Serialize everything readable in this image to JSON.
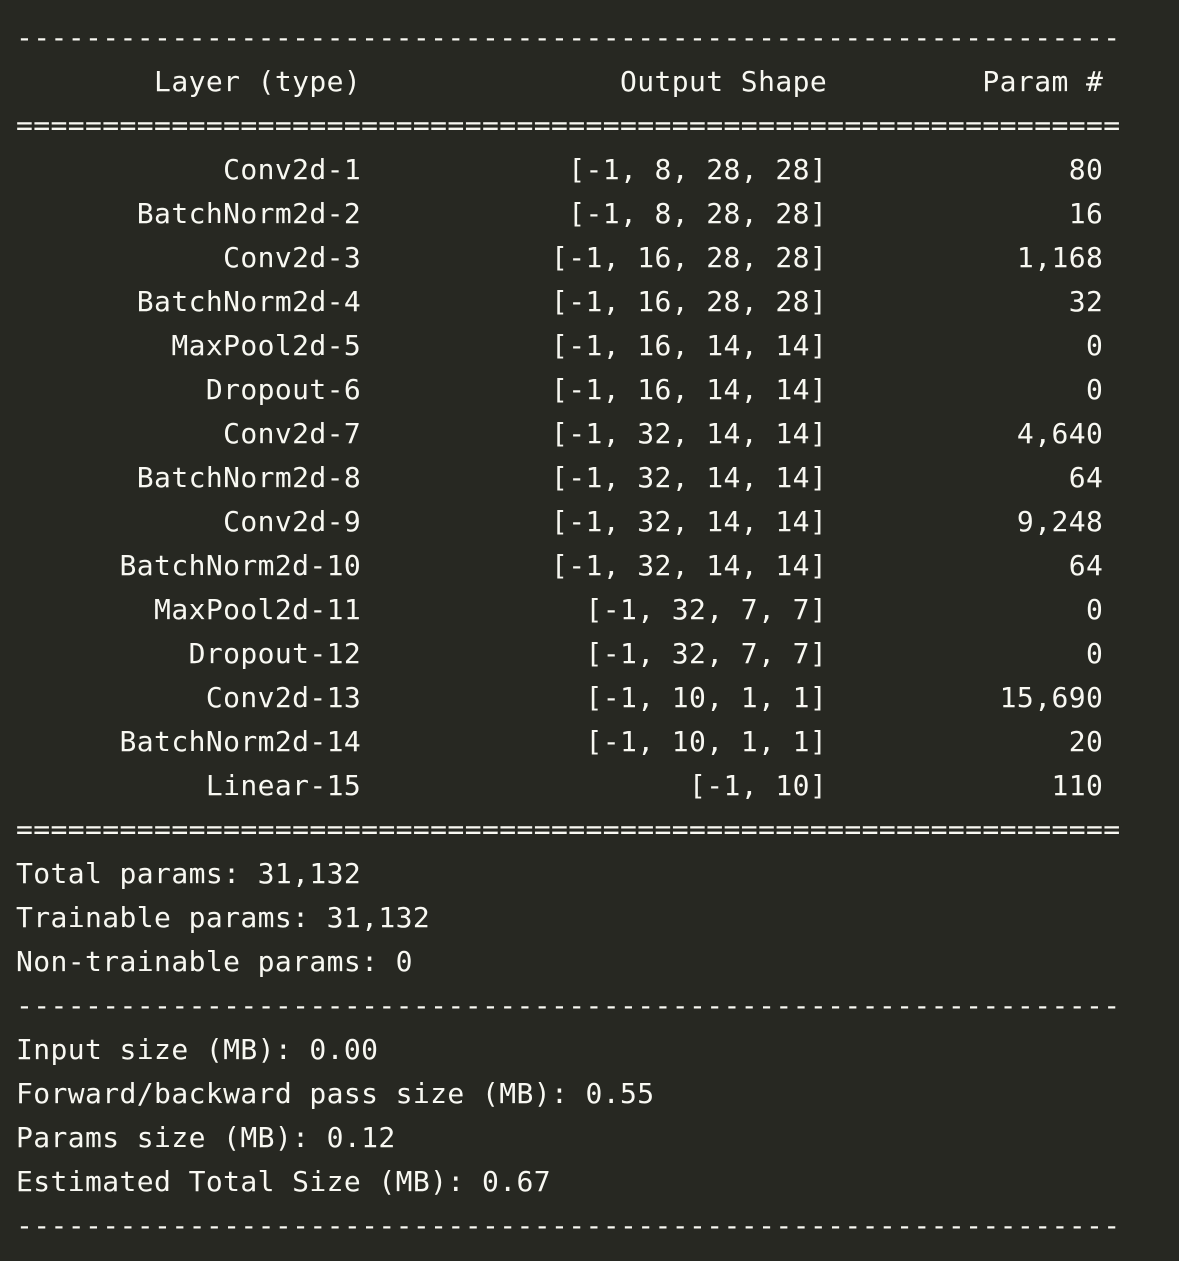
{
  "console": {
    "lines": [
      "----------------------------------------------------------------",
      "        Layer (type)               Output Shape         Param #",
      "================================================================",
      "            Conv2d-1            [-1, 8, 28, 28]              80",
      "       BatchNorm2d-2            [-1, 8, 28, 28]              16",
      "            Conv2d-3           [-1, 16, 28, 28]           1,168",
      "       BatchNorm2d-4           [-1, 16, 28, 28]              32",
      "         MaxPool2d-5           [-1, 16, 14, 14]               0",
      "           Dropout-6           [-1, 16, 14, 14]               0",
      "            Conv2d-7           [-1, 32, 14, 14]           4,640",
      "       BatchNorm2d-8           [-1, 32, 14, 14]              64",
      "            Conv2d-9           [-1, 32, 14, 14]           9,248",
      "      BatchNorm2d-10           [-1, 32, 14, 14]              64",
      "        MaxPool2d-11             [-1, 32, 7, 7]               0",
      "          Dropout-12             [-1, 32, 7, 7]               0",
      "           Conv2d-13             [-1, 10, 1, 1]          15,690",
      "      BatchNorm2d-14             [-1, 10, 1, 1]              20",
      "           Linear-15                   [-1, 10]             110",
      "================================================================",
      "Total params: 31,132",
      "Trainable params: 31,132",
      "Non-trainable params: 0",
      "----------------------------------------------------------------",
      "Input size (MB): 0.00",
      "Forward/backward pass size (MB): 0.55",
      "Params size (MB): 0.12",
      "Estimated Total Size (MB): 0.67",
      "----------------------------------------------------------------"
    ]
  },
  "colors": {
    "background": "#272822",
    "text": "#f8f8f2"
  }
}
